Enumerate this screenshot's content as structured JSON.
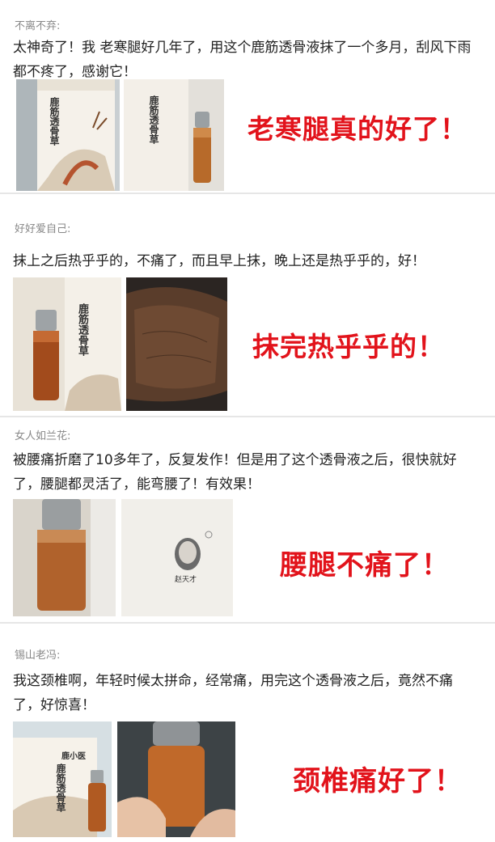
{
  "posts": [
    {
      "username": "不离不弃:",
      "text": "太神奇了！我 老寒腿好几年了，用这个鹿筋透骨液抹了一个多月，刮风下雨都不疼了，感谢它！",
      "slogan": "老寒腿真的好了！"
    },
    {
      "username": "好好爱自己:",
      "text": "抹上之后热乎乎的，不痛了，而且早上抹，晚上还是热乎乎的，好！",
      "slogan": "抹完热乎乎的！"
    },
    {
      "username": "女人如兰花:",
      "text": "被腰痛折磨了10多年了，反复发作！但是用了这个透骨液之后，很快就好了，腰腿都灵活了，能弯腰了！有效果！",
      "slogan": "腰腿不痛了！"
    },
    {
      "username": "锡山老冯:",
      "text": "我这颈椎啊，年轻时候太拼命，经常痛，用完这个透骨液之后，竟然不痛了，好惊喜！",
      "slogan": "颈椎痛好了！"
    }
  ],
  "product": {
    "box_title": "鹿筋透骨草",
    "brand": "鹿小医",
    "portrait_caption": "赵天才"
  },
  "colors": {
    "slogan": "#e2131b",
    "username": "#888888",
    "body_text": "#222222",
    "separator": "#e6e6e6"
  }
}
